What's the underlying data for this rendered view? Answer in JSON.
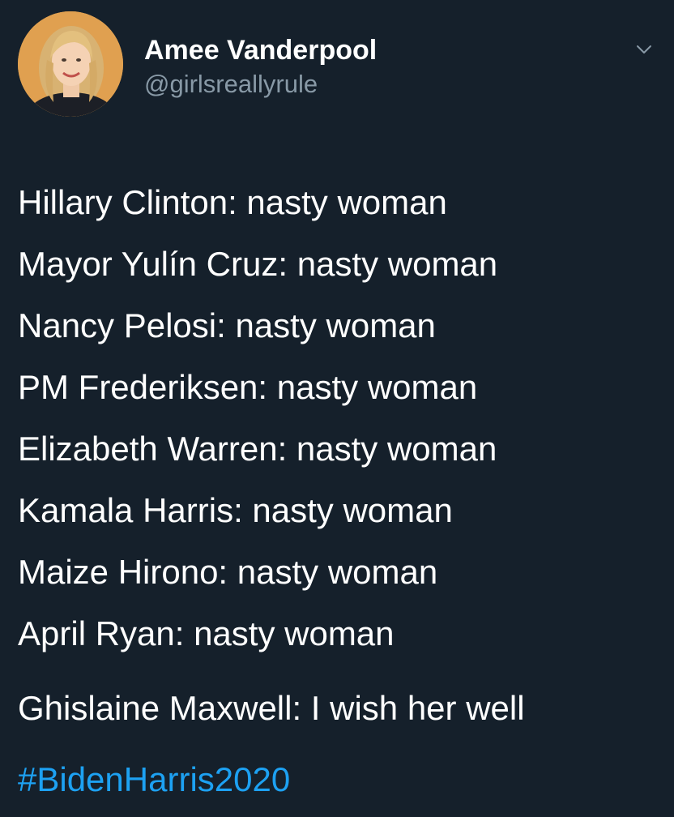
{
  "author": {
    "display_name": "Amee Vanderpool",
    "handle": "@girlsreallyrule"
  },
  "menu": {
    "icon": "chevron-down-icon"
  },
  "tweet": {
    "lines": [
      "Hillary Clinton: nasty woman",
      "Mayor Yulín Cruz: nasty woman",
      "Nancy Pelosi: nasty woman",
      "PM Frederiksen: nasty woman",
      "Elizabeth Warren: nasty woman",
      "Kamala Harris: nasty woman",
      "Maize Hirono: nasty woman",
      "April Ryan: nasty woman"
    ],
    "closing_line": "Ghislaine Maxwell: I wish her well",
    "hashtag": "#BidenHarris2020"
  },
  "colors": {
    "background": "#15202b",
    "text": "#ffffff",
    "handle": "#8899a6",
    "link": "#1da1f2"
  }
}
